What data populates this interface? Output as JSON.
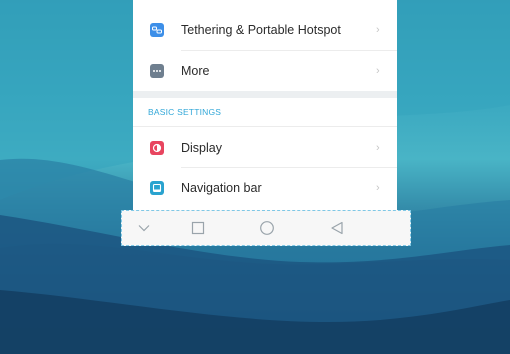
{
  "settings": {
    "items": [
      {
        "label": "Tethering & Portable Hotspot",
        "icon": "tethering-icon",
        "color": "#3d8fe8"
      },
      {
        "label": "More",
        "icon": "more-icon",
        "color": "#6f7f8f"
      },
      {
        "label": "Display",
        "icon": "display-icon",
        "color": "#e8455f"
      },
      {
        "label": "Navigation bar",
        "icon": "navigation-bar-icon",
        "color": "#2aa3cf"
      }
    ],
    "section_title": "BASIC SETTINGS",
    "chevron": "›"
  },
  "navbar": {
    "buttons": [
      {
        "name": "collapse-button",
        "icon": "chevron-down-icon"
      },
      {
        "name": "recent-apps-button",
        "icon": "square-icon"
      },
      {
        "name": "home-button",
        "icon": "circle-icon"
      },
      {
        "name": "back-button",
        "icon": "triangle-back-icon"
      }
    ]
  },
  "colors": {
    "accent": "#31a7d8",
    "highlight_border": "#7fc8e6"
  }
}
